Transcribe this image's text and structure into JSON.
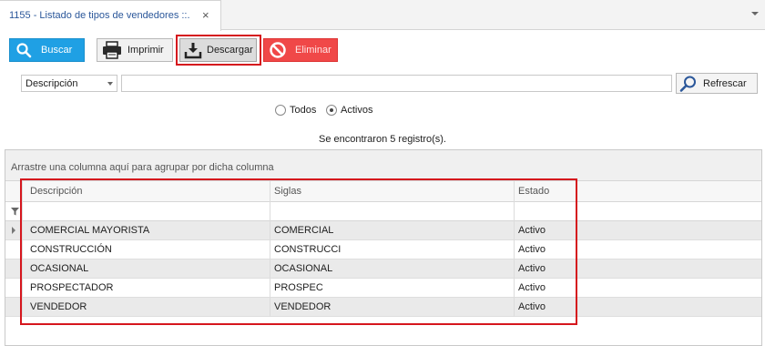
{
  "tab": {
    "title": "1155 - Listado de tipos de vendedores ::.",
    "close_glyph": "×"
  },
  "toolbar": {
    "buscar": "Buscar",
    "imprimir": "Imprimir",
    "descargar": "Descargar",
    "eliminar": "Eliminar"
  },
  "filter": {
    "field_selected": "Descripción",
    "search_value": "",
    "refrescar": "Refrescar"
  },
  "status_filter": {
    "options": [
      "Todos",
      "Activos"
    ],
    "selected": "Activos"
  },
  "result_count": "Se encontraron 5 registro(s).",
  "grid": {
    "group_panel_text": "Arrastre una columna aquí para agrupar por dicha columna",
    "columns": [
      "Descripción",
      "Siglas",
      "Estado"
    ],
    "rows": [
      [
        "COMERCIAL MAYORISTA",
        "COMERCIAL",
        "Activo"
      ],
      [
        "CONSTRUCCIÓN",
        "CONSTRUCCI",
        "Activo"
      ],
      [
        "OCASIONAL",
        "OCASIONAL",
        "Activo"
      ],
      [
        "PROSPECTADOR",
        "PROSPEC",
        "Activo"
      ],
      [
        "VENDEDOR",
        "VENDEDOR",
        "Activo"
      ]
    ]
  },
  "colors": {
    "buscar_bg": "#1fa0e4",
    "eliminar_bg": "#f04848",
    "highlight": "#d5161d",
    "tab_title": "#2b579a"
  }
}
